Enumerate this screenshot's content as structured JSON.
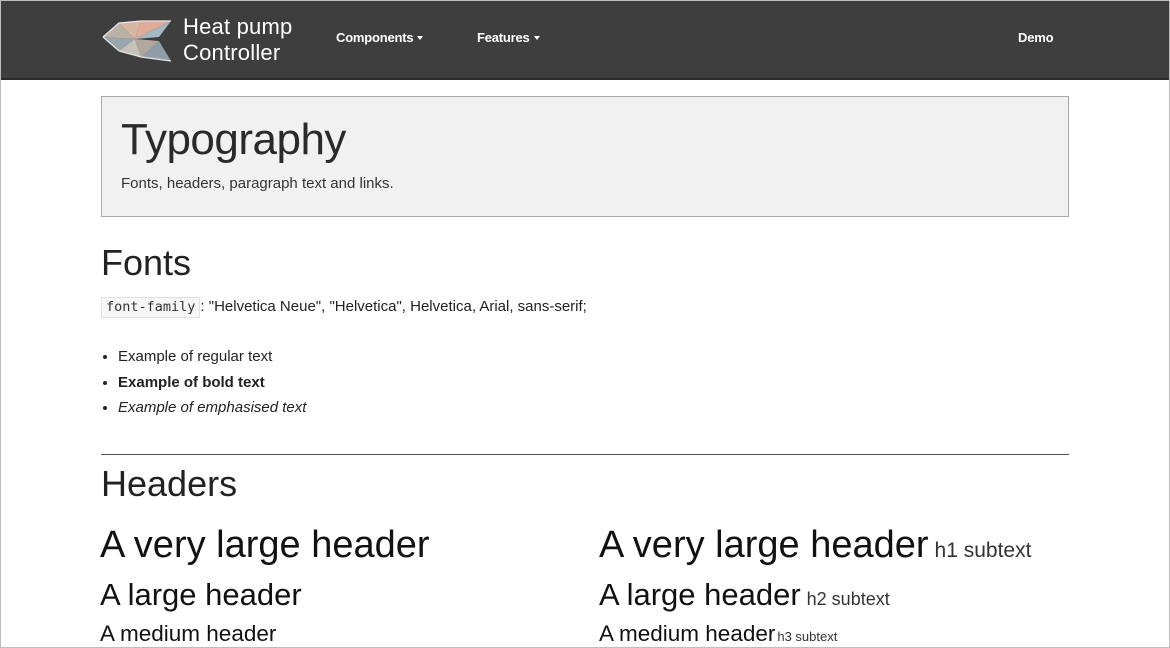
{
  "navbar": {
    "brand_line1": "Heat pump",
    "brand_line2": "Controller",
    "logo_icon": "heat-pump-logo-icon",
    "menu": [
      {
        "label": "Components",
        "has_dropdown": true
      },
      {
        "label": "Features",
        "has_dropdown": true
      },
      {
        "label": "Demo",
        "has_dropdown": false
      }
    ],
    "colors": {
      "background": "#3e3e3e",
      "text": "#ffffff"
    }
  },
  "jumbotron": {
    "title": "Typography",
    "lead": "Fonts, headers, paragraph text and links.",
    "background": "#f1f1f1"
  },
  "fonts_section": {
    "title": "Fonts",
    "code_label": "font-family",
    "font_stack": ": \"Helvetica Neue\", \"Helvetica\", Helvetica, Arial, sans-serif;",
    "examples": [
      "Example of regular text",
      "Example of bold text",
      "Example of emphasised text"
    ]
  },
  "headers_section": {
    "title": "Headers",
    "left": [
      "A very large header",
      "A large header",
      "A medium header"
    ],
    "right": [
      {
        "text": "A very large header",
        "subtext": "h1 subtext"
      },
      {
        "text": "A large header",
        "subtext": "h2 subtext"
      },
      {
        "text": "A medium header",
        "subtext": "h3 subtext"
      }
    ]
  }
}
